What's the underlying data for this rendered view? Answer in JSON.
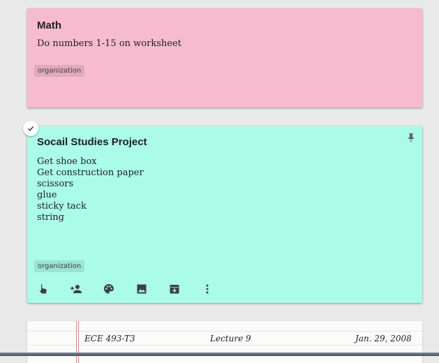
{
  "notes": [
    {
      "title": "Math",
      "body": [
        "Do numbers 1-15 on worksheet"
      ],
      "label": "organization",
      "color": "#f7bbcf"
    },
    {
      "title": "Socail Studies Project",
      "body": [
        "Get shoe box",
        "Get construction paper",
        "scissors",
        "glue",
        "sticky tack",
        "string"
      ],
      "label": "organization",
      "color": "#abfbe9",
      "pinned": true,
      "selected": true,
      "toolbar_icons": [
        "hand-pointer-icon",
        "add-collaborator-icon",
        "palette-icon",
        "image-icon",
        "archive-icon",
        "more-vert-icon"
      ]
    }
  ],
  "image_note": {
    "handwriting": {
      "course": "ECE 493-T3",
      "lecture": "Lecture 9",
      "date": "Jan. 29, 2008"
    }
  }
}
